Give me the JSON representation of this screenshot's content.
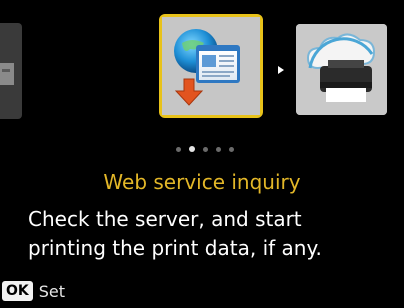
{
  "menu": {
    "selected_icon": "web-service-inquiry-icon",
    "next_icon": "cloud-printer-icon",
    "pager": {
      "current": 2,
      "total": 5
    }
  },
  "content": {
    "title": "Web service inquiry",
    "description_line1": "Check the server, and start",
    "description_line2": "printing the print data, if any."
  },
  "footer": {
    "ok_key": "OK",
    "ok_action": "Set"
  },
  "colors": {
    "accent": "#e8c21a",
    "title": "#e3b728",
    "background": "#000000"
  }
}
